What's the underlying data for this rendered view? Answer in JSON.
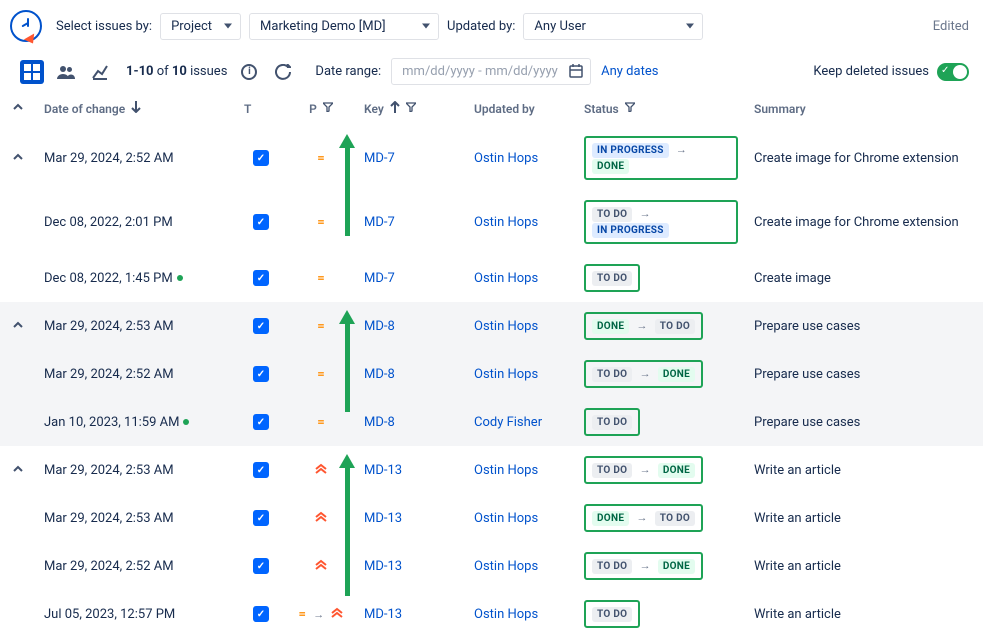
{
  "topbar": {
    "select_label": "Select issues by:",
    "project_dd": "Project",
    "project_value": "Marketing Demo [MD]",
    "updated_by_label": "Updated by:",
    "updated_by_value": "Any User",
    "edited": "Edited"
  },
  "secondbar": {
    "count_prefix": "1-10",
    "count_mid": "of",
    "count_total": "10",
    "count_suffix": "issues",
    "date_range_label": "Date range:",
    "date_placeholder": "mm/dd/yyyy - mm/dd/yyyy",
    "any_dates": "Any dates",
    "keep_deleted": "Keep deleted issues"
  },
  "headers": {
    "date": "Date of change",
    "t": "T",
    "p": "P",
    "key": "Key",
    "updated_by": "Updated by",
    "status": "Status",
    "summary": "Summary"
  },
  "status_labels": {
    "todo": "TO DO",
    "in_progress": "IN PROGRESS",
    "done": "DONE"
  },
  "rows": [
    {
      "group": 0,
      "chev": true,
      "date": "Mar 29, 2024, 2:52 AM",
      "dot": false,
      "prio": "eq",
      "key": "MD-7",
      "user": "Ostin Hops",
      "status_from": "in_progress",
      "status_to": "done",
      "summary": "Create image for Chrome extension"
    },
    {
      "group": 0,
      "chev": false,
      "date": "Dec 08, 2022, 2:01 PM",
      "dot": false,
      "prio": "eq",
      "key": "MD-7",
      "user": "Ostin Hops",
      "status_from": "todo",
      "status_to": "in_progress",
      "summary": "Create image for Chrome extension"
    },
    {
      "group": 0,
      "chev": false,
      "date": "Dec 08, 2022, 1:45 PM",
      "dot": true,
      "prio": "eq",
      "key": "MD-7",
      "user": "Ostin Hops",
      "status_from": "todo",
      "status_to": null,
      "summary": "Create image"
    },
    {
      "group": 1,
      "chev": true,
      "date": "Mar 29, 2024, 2:53 AM",
      "dot": false,
      "prio": "eq",
      "key": "MD-8",
      "user": "Ostin Hops",
      "status_from": "done",
      "status_to": "todo",
      "summary": "Prepare use cases"
    },
    {
      "group": 1,
      "chev": false,
      "date": "Mar 29, 2024, 2:52 AM",
      "dot": false,
      "prio": "eq",
      "key": "MD-8",
      "user": "Ostin Hops",
      "status_from": "todo",
      "status_to": "done",
      "summary": "Prepare use cases"
    },
    {
      "group": 1,
      "chev": false,
      "date": "Jan 10, 2023, 11:59 AM",
      "dot": true,
      "prio": "eq",
      "key": "MD-8",
      "user": "Cody Fisher",
      "status_from": "todo",
      "status_to": null,
      "summary": "Prepare use cases"
    },
    {
      "group": 2,
      "chev": true,
      "date": "Mar 29, 2024, 2:53 AM",
      "dot": false,
      "prio": "hi",
      "key": "MD-13",
      "user": "Ostin Hops",
      "status_from": "todo",
      "status_to": "done",
      "summary": "Write an article"
    },
    {
      "group": 2,
      "chev": false,
      "date": "Mar 29, 2024, 2:53 AM",
      "dot": false,
      "prio": "hi",
      "key": "MD-13",
      "user": "Ostin Hops",
      "status_from": "done",
      "status_to": "todo",
      "summary": "Write an article"
    },
    {
      "group": 2,
      "chev": false,
      "date": "Mar 29, 2024, 2:52 AM",
      "dot": false,
      "prio": "hi",
      "key": "MD-13",
      "user": "Ostin Hops",
      "status_from": "todo",
      "status_to": "done",
      "summary": "Write an article"
    },
    {
      "group": 2,
      "chev": false,
      "date": "Jul 05, 2023, 12:57 PM",
      "dot": false,
      "prio": "eq-to-hi",
      "key": "MD-13",
      "user": "Ostin Hops",
      "status_from": "todo",
      "status_to": null,
      "summary": "Write an article"
    }
  ],
  "group_arrows": {
    "0": 88,
    "1": 88,
    "2": 128
  }
}
